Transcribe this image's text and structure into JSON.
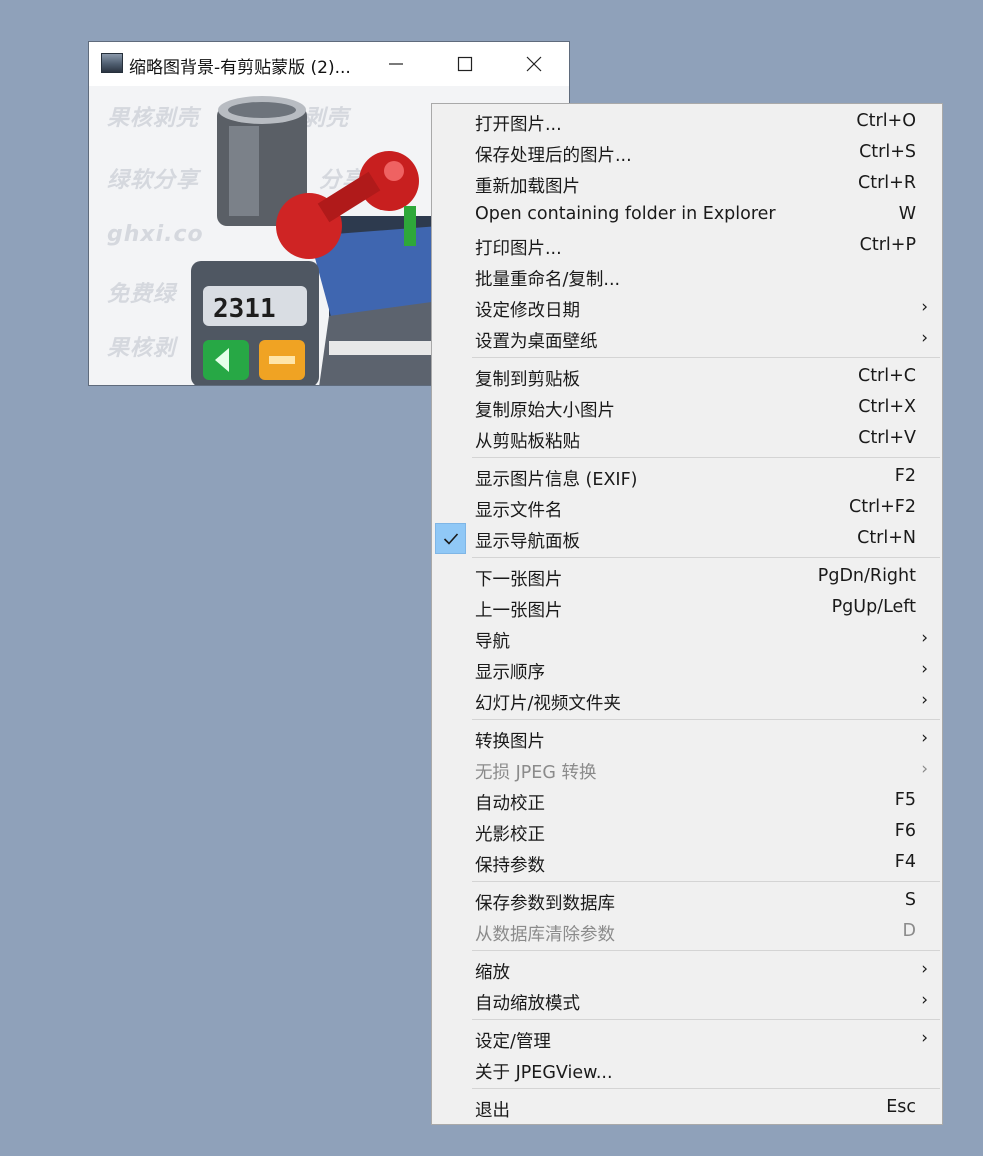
{
  "window": {
    "title": "缩略图背景-有剪贴蒙版 (2)...",
    "watermarks": [
      "果核剥壳",
      "果核剥壳",
      "绿软分享",
      "分享",
      "ghxi.co",
      "免费绿",
      "果核剥"
    ],
    "lcd_text": "2311"
  },
  "menu": {
    "items": [
      {
        "label": "打开图片...",
        "shortcut": "Ctrl+O"
      },
      {
        "label": "保存处理后的图片...",
        "shortcut": "Ctrl+S"
      },
      {
        "label": "重新加载图片",
        "shortcut": "Ctrl+R"
      },
      {
        "label": "Open containing folder in Explorer",
        "shortcut": "W"
      },
      {
        "label": "打印图片...",
        "shortcut": "Ctrl+P"
      },
      {
        "label": "批量重命名/复制...",
        "shortcut": ""
      },
      {
        "label": "设定修改日期",
        "shortcut": "",
        "arrow": "›"
      },
      {
        "label": "设置为桌面壁纸",
        "shortcut": "",
        "arrow": "›"
      },
      {
        "label": "复制到剪贴板",
        "shortcut": "Ctrl+C"
      },
      {
        "label": "复制原始大小图片",
        "shortcut": "Ctrl+X"
      },
      {
        "label": "从剪贴板粘贴",
        "shortcut": "Ctrl+V"
      },
      {
        "label": "显示图片信息 (EXIF)",
        "shortcut": "F2"
      },
      {
        "label": "显示文件名",
        "shortcut": "Ctrl+F2"
      },
      {
        "label": "显示导航面板",
        "shortcut": "Ctrl+N",
        "checked": true
      },
      {
        "label": "下一张图片",
        "shortcut": "PgDn/Right"
      },
      {
        "label": "上一张图片",
        "shortcut": "PgUp/Left"
      },
      {
        "label": "导航",
        "shortcut": "",
        "arrow": "›"
      },
      {
        "label": "显示顺序",
        "shortcut": "",
        "arrow": "›"
      },
      {
        "label": "幻灯片/视频文件夹",
        "shortcut": "",
        "arrow": "›"
      },
      {
        "label": "转换图片",
        "shortcut": "",
        "arrow": "›"
      },
      {
        "label": "无损 JPEG 转换",
        "shortcut": "",
        "arrow": "›",
        "disabled": true
      },
      {
        "label": "自动校正",
        "shortcut": "F5"
      },
      {
        "label": "光影校正",
        "shortcut": "F6"
      },
      {
        "label": "保持参数",
        "shortcut": "F4"
      },
      {
        "label": "保存参数到数据库",
        "shortcut": "S"
      },
      {
        "label": "从数据库清除参数",
        "shortcut": "D",
        "disabled": true
      },
      {
        "label": "缩放",
        "shortcut": "",
        "arrow": "›"
      },
      {
        "label": "自动缩放模式",
        "shortcut": "",
        "arrow": "›"
      },
      {
        "label": "设定/管理",
        "shortcut": "",
        "arrow": "›"
      },
      {
        "label": "关于 JPEGView...",
        "shortcut": ""
      },
      {
        "label": "退出",
        "shortcut": "Esc"
      }
    ]
  },
  "colors": {
    "desktop": "#8fa1ba",
    "menu_bg": "#f0f0f0",
    "check_highlight": "#90c8f6",
    "disabled_text": "#8b8b8b"
  }
}
